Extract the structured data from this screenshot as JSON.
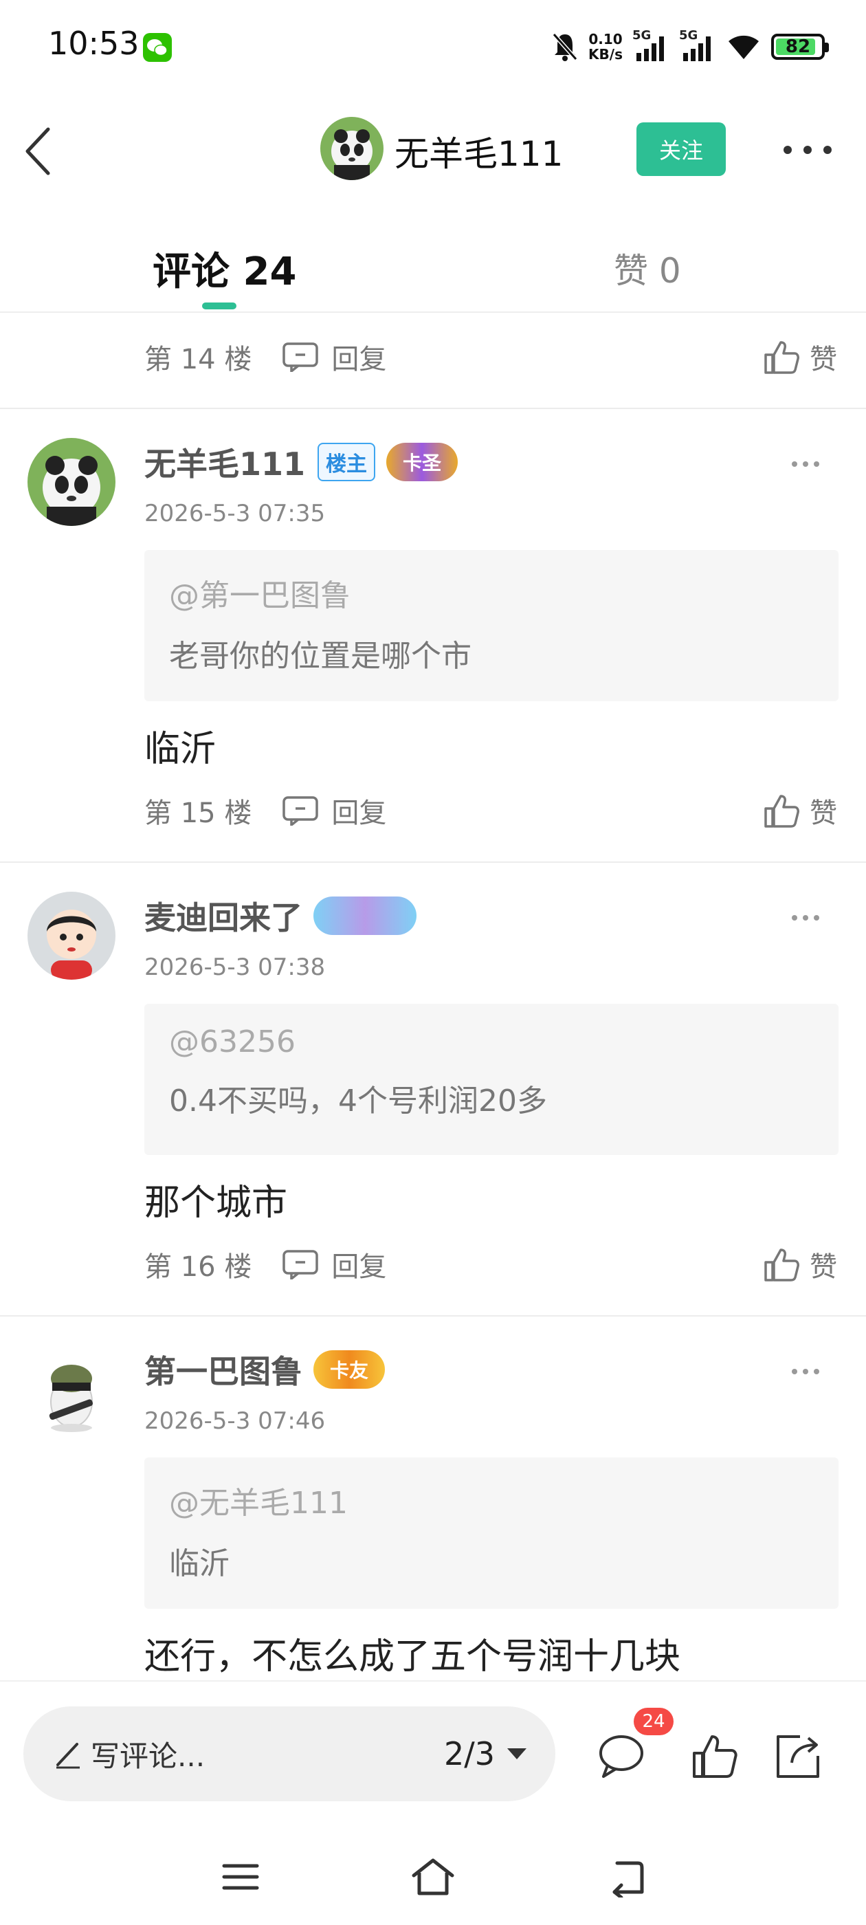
{
  "status_bar": {
    "time": "10:53",
    "net_speed_value": "0.10",
    "net_speed_unit": "KB/s",
    "signal_1": "5G",
    "signal_2": "5G",
    "battery": "82",
    "icons": [
      "wechat-icon",
      "mute-icon",
      "signal-icon",
      "signal-icon",
      "wifi-icon",
      "battery-icon"
    ]
  },
  "header": {
    "username": "无羊毛111",
    "follow_label": "关注",
    "back_icon": "chevron-left-icon",
    "more_icon": "more-horizontal-icon"
  },
  "tabs": {
    "comments_label": "评论 24",
    "likes_label": "赞 0"
  },
  "comments": [
    {
      "floor": "第 14 楼",
      "reply_label": "回复",
      "like_label": "赞"
    },
    {
      "username": "无羊毛111",
      "owner_tag": "楼主",
      "badge": "卡圣",
      "time": "2026-5-3 07:35",
      "quote_at": "@第一巴图鲁",
      "quote_text": "老哥你的位置是哪个市",
      "body": "临沂",
      "floor": "第 15 楼",
      "reply_label": "回复",
      "like_label": "赞"
    },
    {
      "username": "麦迪回来了",
      "badge": "",
      "time": "2026-5-3 07:38",
      "quote_at": "@63256",
      "quote_text": "0.4不买吗，4个号利润20多",
      "body": "那个城市",
      "floor": "第 16 楼",
      "reply_label": "回复",
      "like_label": "赞"
    },
    {
      "username": "第一巴图鲁",
      "badge": "卡友",
      "time": "2026-5-3 07:46",
      "quote_at": "@无羊毛111",
      "quote_text": "临沂",
      "body": "还行，不怎么成了五个号润十几块"
    }
  ],
  "bottom_bar": {
    "comment_placeholder": "写评论...",
    "page_indicator": "2/3",
    "comment_count": "24",
    "icons": [
      "pencil-icon",
      "comment-icon",
      "thumbs-up-icon",
      "share-icon"
    ]
  },
  "nav_bar": {
    "icons": [
      "menu-icon",
      "home-icon",
      "back-icon"
    ]
  },
  "colors": {
    "accent": "#2dbf94",
    "badge_red": "#f54a45",
    "owner_tag": "#2b8de0"
  }
}
